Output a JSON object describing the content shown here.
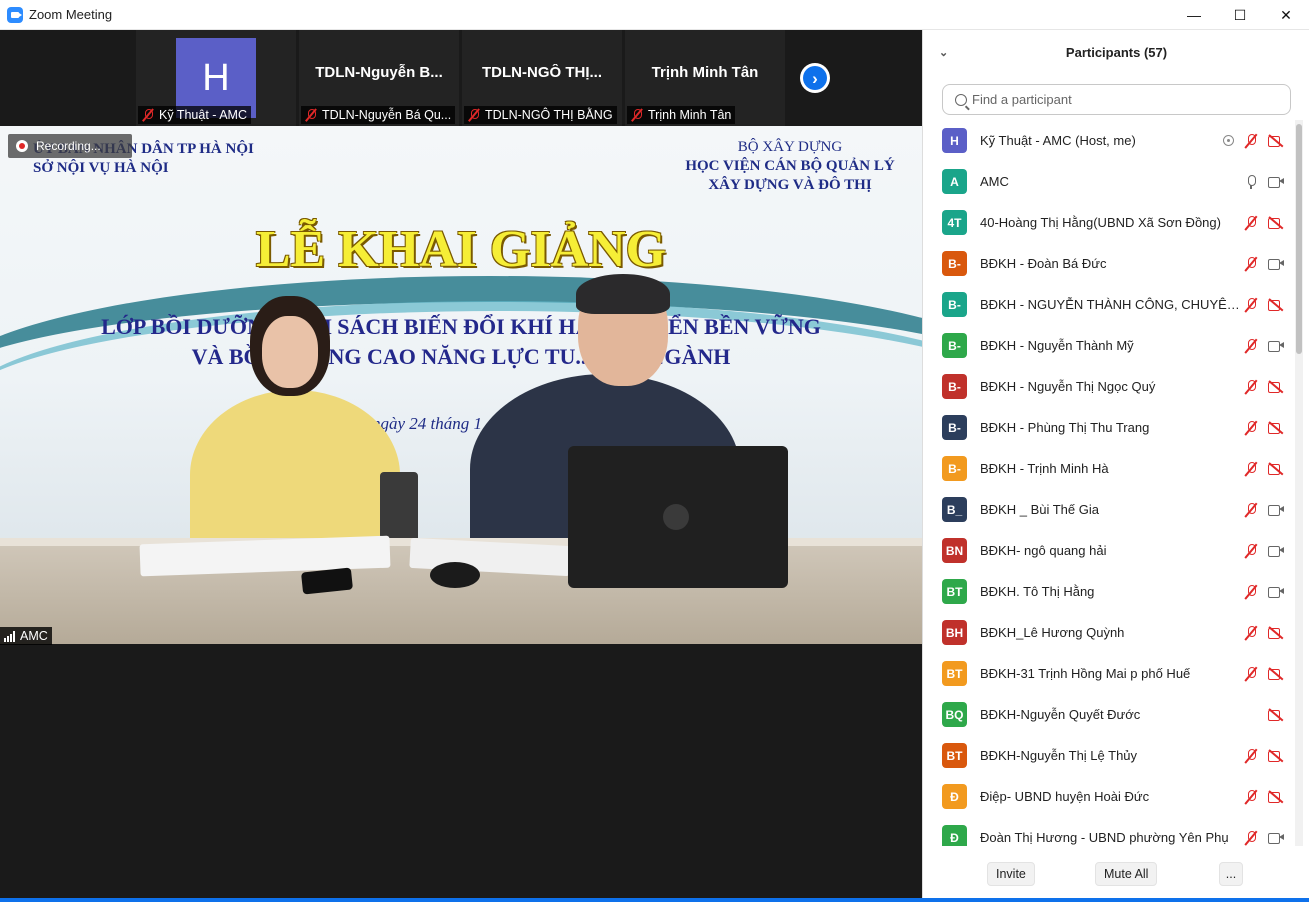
{
  "window": {
    "title": "Zoom Meeting",
    "minimize": "—",
    "maximize": "☐",
    "close": "✕"
  },
  "gallery": [
    {
      "display": "H",
      "caption": "Kỹ Thuật - AMC"
    },
    {
      "display": "TDLN-Nguyễn  B...",
      "caption": "TDLN-Nguyễn Bá Qu..."
    },
    {
      "display": "TDLN-NGÔ  THỊ...",
      "caption": "TDLN-NGÔ THỊ BẰNG"
    },
    {
      "display": "Trịnh Minh Tân",
      "caption": "Trịnh Minh Tân"
    }
  ],
  "gallery_next": "›",
  "recording": {
    "label": "Recording..."
  },
  "main_video": {
    "speaker": "AMC",
    "slide": {
      "org_left": [
        "ỦY BAN NHÂN DÂN TP HÀ NỘI",
        "SỞ NỘI VỤ HÀ NỘI"
      ],
      "org_right": [
        "BỘ XÂY DỰNG",
        "HỌC VIỆN CÁN BỘ QUẢN LÝ",
        "XÂY DỰNG VÀ ĐÔ THỊ"
      ],
      "headline": "LỄ KHAI GIẢNG",
      "line1": "LỚP BỒI DƯỠNG V...H SÁCH BIẾN ĐỔI KHÍ HẬU... TRIỂN BỀN VỮNG",
      "line2": "VÀ BỒI ... NÂNG CAO NĂNG LỰC TU... YÊN NGÀNH",
      "date": "ngày 24 tháng 1"
    }
  },
  "panel": {
    "title": "Participants (57)",
    "collapse": "⌄",
    "search_placeholder": "Find a participant",
    "participants": [
      {
        "initials": "H",
        "color": "#5b5fc7",
        "name": "Kỹ Thuật - AMC (Host, me)",
        "mic": "off",
        "cam": "off",
        "share": true
      },
      {
        "initials": "A",
        "color": "#1aa58a",
        "name": "AMC",
        "mic": "on",
        "cam": "on",
        "share": false
      },
      {
        "initials": "4T",
        "color": "#1aa58a",
        "name": "40-Hoàng Thị Hằng(UBND Xã Sơn Đồng)",
        "mic": "off",
        "cam": "off",
        "share": false
      },
      {
        "initials": "B-",
        "color": "#d9580d",
        "name": "BĐKH - Đoàn Bá Đức",
        "mic": "off",
        "cam": "on",
        "share": false
      },
      {
        "initials": "B-",
        "color": "#1aa58a",
        "name": "BĐKH - NGUYỄN THÀNH CÔNG, CHUYÊN ...",
        "mic": "off",
        "cam": "off",
        "share": false
      },
      {
        "initials": "B-",
        "color": "#2ea84a",
        "name": "BĐKH - Nguyễn Thành Mỹ",
        "mic": "off",
        "cam": "on",
        "share": false
      },
      {
        "initials": "B-",
        "color": "#c0312b",
        "name": "BĐKH - Nguyễn Thị Ngọc Quý",
        "mic": "off",
        "cam": "off",
        "share": false
      },
      {
        "initials": "B-",
        "color": "#2c3e5c",
        "name": "BĐKH - Phùng Thị Thu Trang",
        "mic": "off",
        "cam": "off",
        "share": false
      },
      {
        "initials": "B-",
        "color": "#f29a1f",
        "name": "BĐKH - Trịnh Minh Hà",
        "mic": "off",
        "cam": "off",
        "share": false
      },
      {
        "initials": "B_",
        "color": "#2c3e5c",
        "name": "BĐKH _ Bùi Thế Gia",
        "mic": "off",
        "cam": "on",
        "share": false
      },
      {
        "initials": "BN",
        "color": "#c0312b",
        "name": "BĐKH- ngô quang hải",
        "mic": "off",
        "cam": "on",
        "share": false
      },
      {
        "initials": "BT",
        "color": "#2ea84a",
        "name": "BĐKH. Tô Thị Hằng",
        "mic": "off",
        "cam": "on",
        "share": false
      },
      {
        "initials": "BH",
        "color": "#c0312b",
        "name": "BĐKH_Lê Hương Quỳnh",
        "mic": "off",
        "cam": "off",
        "share": false
      },
      {
        "initials": "BT",
        "color": "#f29a1f",
        "name": "BĐKH-31 Trịnh Hồng Mai p phố Huế",
        "mic": "off",
        "cam": "off",
        "share": false
      },
      {
        "initials": "BQ",
        "color": "#2ea84a",
        "name": "BĐKH-Nguyễn Quyết Đước",
        "mic": "none",
        "cam": "off",
        "share": false
      },
      {
        "initials": "BT",
        "color": "#d9580d",
        "name": "BĐKH-Nguyễn Thị Lệ Thủy",
        "mic": "off",
        "cam": "off",
        "share": false
      },
      {
        "initials": "Đ",
        "color": "#f29a1f",
        "name": "Điệp- UBND huyện Hoài Đức",
        "mic": "off",
        "cam": "off",
        "share": false
      },
      {
        "initials": "Đ",
        "color": "#2ea84a",
        "name": "Đoàn Thị Hương - UBND phường Yên Phụ",
        "mic": "off",
        "cam": "on",
        "share": false
      }
    ],
    "footer": {
      "invite": "Invite",
      "mute_all": "Mute All",
      "more": "..."
    }
  }
}
